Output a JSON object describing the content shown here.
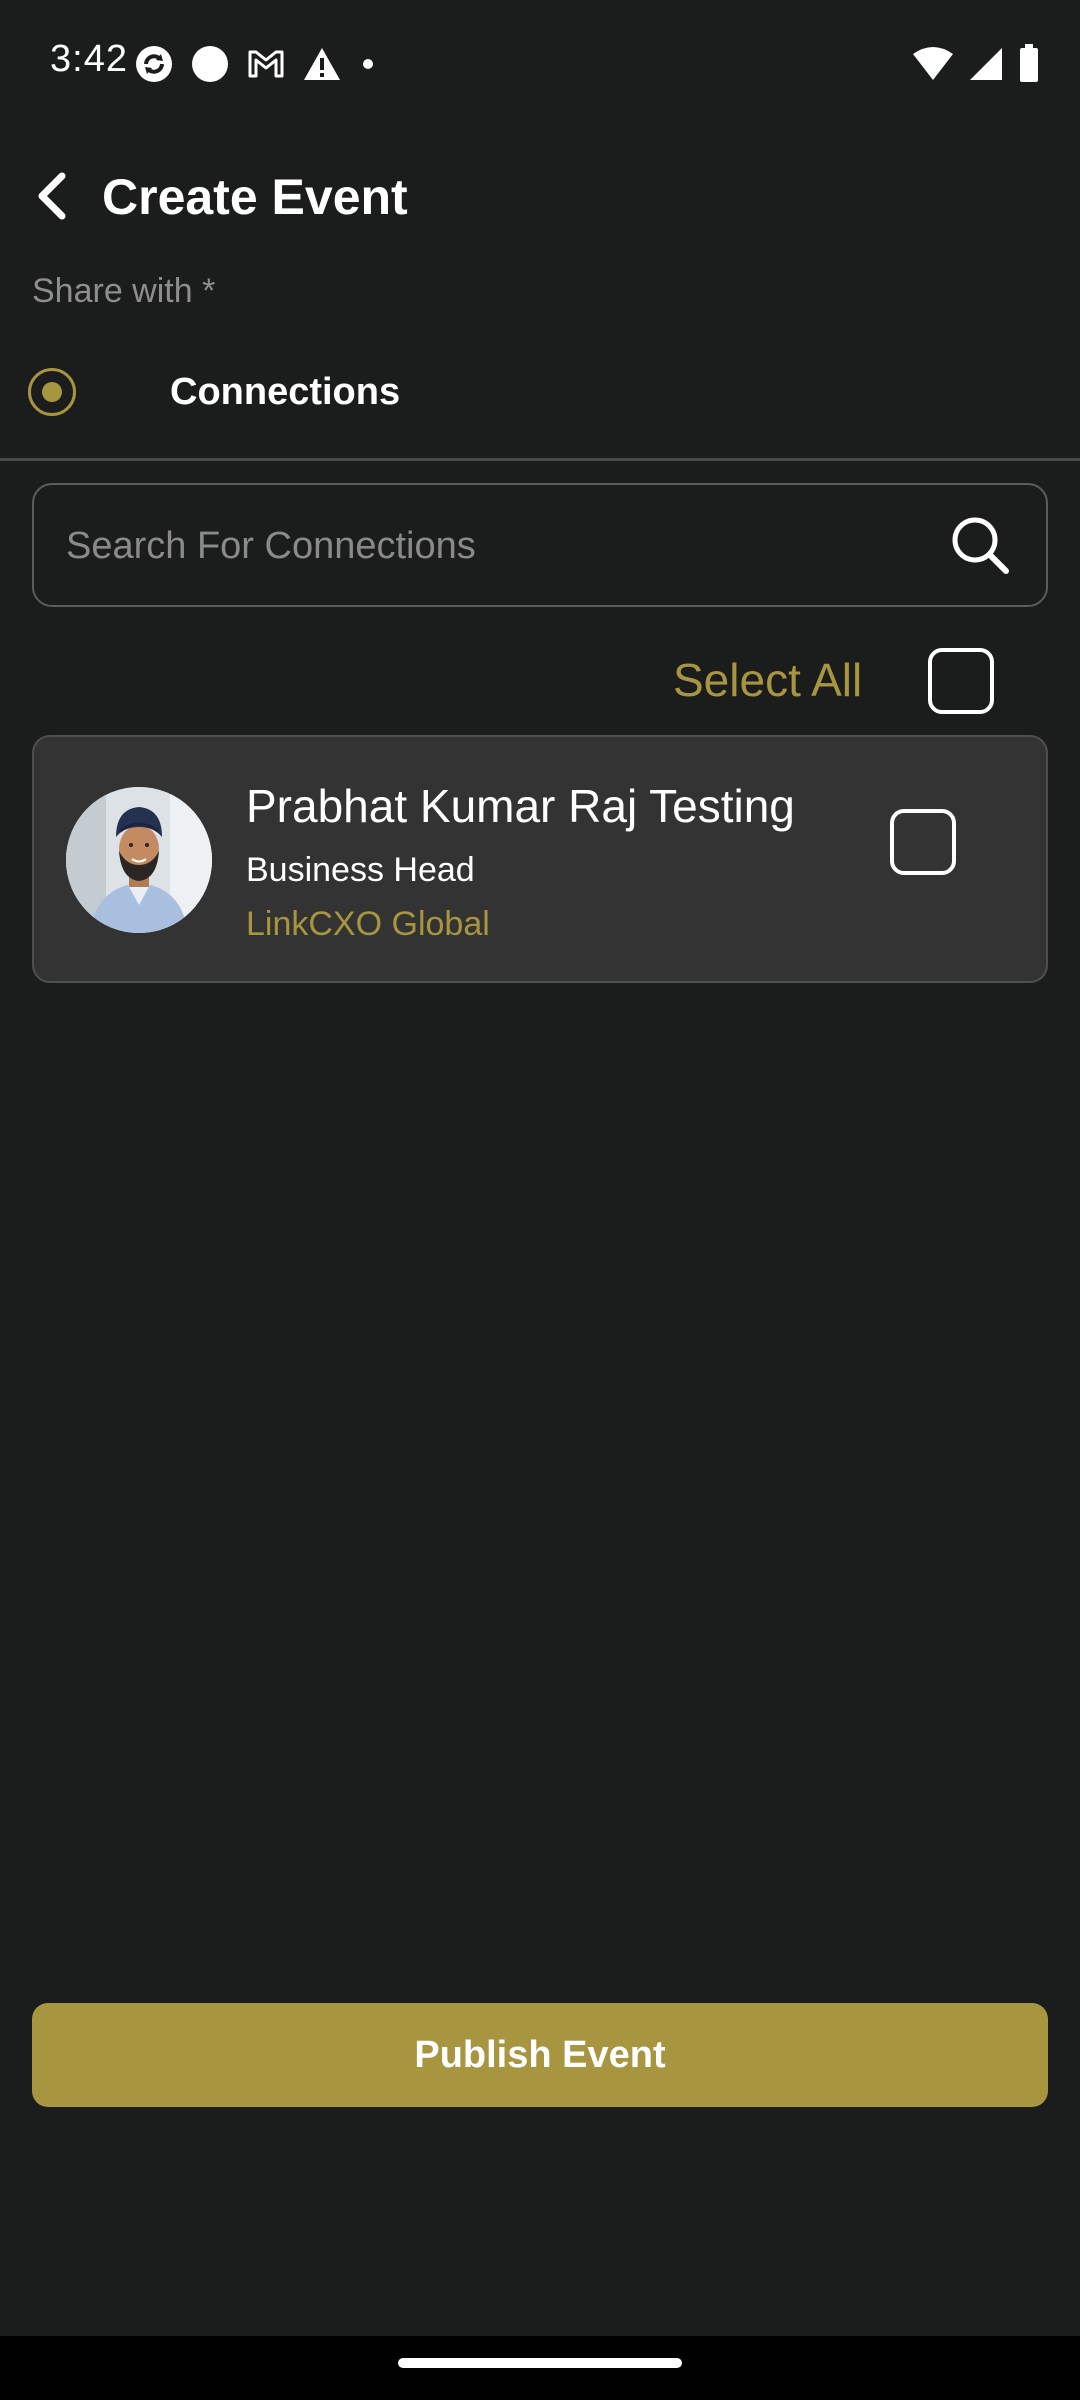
{
  "status_bar": {
    "time": "3:42",
    "icons_left": [
      "sync-icon",
      "circle-icon",
      "gmail-icon",
      "warning-icon",
      "dot-icon"
    ],
    "icons_right": [
      "wifi-icon",
      "signal-icon",
      "battery-icon"
    ]
  },
  "header": {
    "title": "Create Event",
    "back_icon": "chevron-left-icon"
  },
  "share": {
    "label": "Share with *",
    "option_label": "Connections",
    "option_selected": true
  },
  "search": {
    "placeholder": "Search For Connections",
    "value": "",
    "icon": "search-icon"
  },
  "select_all": {
    "label": "Select All",
    "checked": false
  },
  "connections": [
    {
      "name": "Prabhat Kumar Raj Testing",
      "role": "Business Head",
      "company": "LinkCXO Global",
      "checked": false
    }
  ],
  "publish_button": {
    "label": "Publish Event"
  },
  "colors": {
    "background": "#1b1c1c",
    "accent": "#a8953f",
    "card": "#333333",
    "muted_text": "#8e8e8e"
  }
}
